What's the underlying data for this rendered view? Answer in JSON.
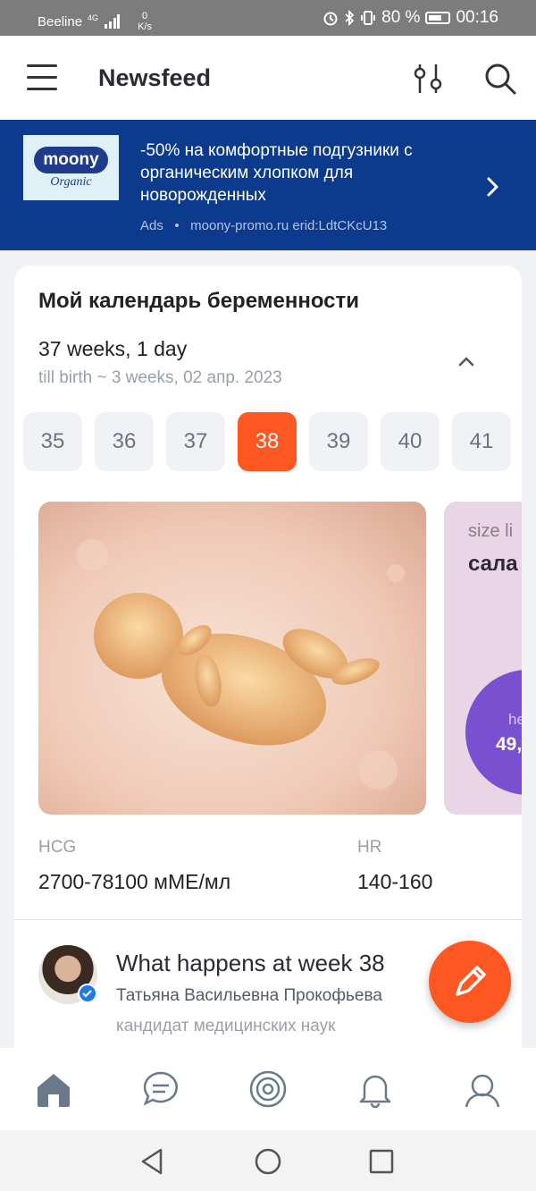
{
  "status_bar": {
    "carrier": "Beeline",
    "network": "4G",
    "speed_value": "0",
    "speed_unit": "K/s",
    "battery": "80 %",
    "time": "00:16"
  },
  "header": {
    "title": "Newsfeed",
    "menu_icon": "menu-icon",
    "filter_icon": "filter-icon",
    "search_icon": "search-icon"
  },
  "ad": {
    "logo_brand": "moony",
    "logo_sub": "Organic",
    "text": "-50% на комфортные подгузники с органическим хлопком для новорожденных",
    "label": "Ads",
    "separator": "•",
    "source": "moony-promo.ru erid:LdtCKcU13",
    "bg_color": "#0c3b8e"
  },
  "calendar": {
    "title": "Мой календарь беременности",
    "weeks_text": "37 weeks, 1 day",
    "birth_text": "till birth ~ 3 weeks, 02 апр. 2023",
    "weeks": [
      "35",
      "36",
      "37",
      "38",
      "39",
      "40",
      "41"
    ],
    "selected_week": "38",
    "accent_color": "#ff5722",
    "size_label": "size li",
    "size_value": "сала",
    "circle_label": "he",
    "circle_value": "49,",
    "hcg_label": "HCG",
    "hcg_value": "2700-78100 мМЕ/мл",
    "hr_label": "HR",
    "hr_value": "140-160"
  },
  "article": {
    "title": "What happens at week 38",
    "author": "Татьяна Васильевна Прокофьева",
    "role": "кандидат медицинских наук"
  },
  "fab": {
    "icon": "pencil-icon"
  },
  "bottom_nav": {
    "items": [
      "home-icon",
      "chat-icon",
      "target-icon",
      "bell-icon",
      "profile-icon"
    ],
    "active": "home-icon"
  },
  "system_nav": {
    "items": [
      "back-icon",
      "home-circle-icon",
      "recents-icon"
    ]
  }
}
